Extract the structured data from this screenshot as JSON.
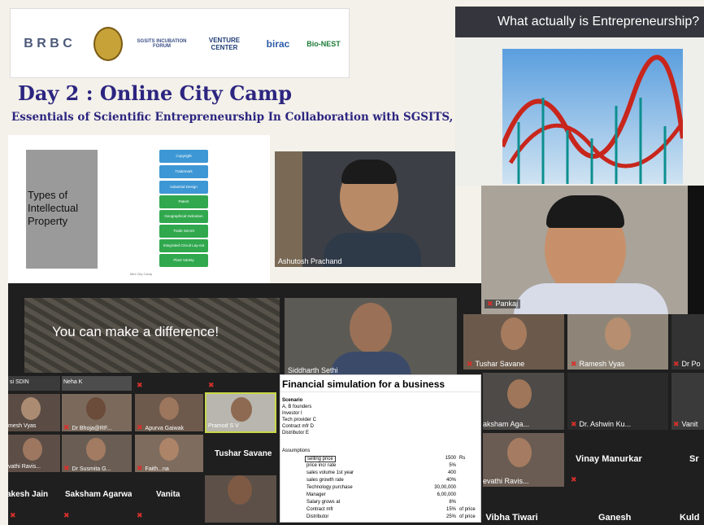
{
  "logos": [
    "B R B C",
    "SGSITS INCUBATION FORUM",
    "VENTURE CENTER",
    "birac",
    "Bio-NEST"
  ],
  "title": "Day 2 : Online City Camp",
  "subtitle": "Essentials of Scientific Entrepreneurship In Collaboration with SGSITS, Indore",
  "ip_slide": {
    "title": "Types of Intellectual Property",
    "items": [
      "Copyright",
      "Trademark",
      "Industrial Design",
      "Patent",
      "Geographical Indication",
      "Trade Secret",
      "Integrated Circuit Lay-out",
      "Plant Variety"
    ],
    "footer": "Mini City Camp"
  },
  "entrepreneurship_heading": "What actually is Entrepreneurship?",
  "difference_text": "You can make a difference!",
  "participants": {
    "ashutosh": "Ashutosh Prachand",
    "pankaj": "Pankaj",
    "siddharth": "Siddharth Sethi",
    "tushar": "Tushar Savane",
    "ramesh": "Ramesh Vyas",
    "dr_po": "Dr Po",
    "saksham_small": "aksham Aga...",
    "ashwin": "Dr. Ashwin Ku...",
    "vanit": "Vanit",
    "vinay": "Vinay Manurkar",
    "sr": "Sr",
    "revathi_r": "evathi Ravis...",
    "vibha": "r Vibha Tiwari",
    "ganesh": "Ganesh",
    "kuld": "Kuld",
    "sdin": "si SDIN",
    "neha": "Neha K",
    "ramesh_l": "mesh Vyas",
    "bhoja": "Dr Bhoja@RF...",
    "apurva": "Apurva Gaiwak",
    "pramod": "Pramod S V",
    "tushar_big": "Tushar Savane",
    "revathi_l": "vathi Ravis...",
    "susmita": "Dr Susmita G...",
    "faith": "Faith...na",
    "akesh": "akesh Jain",
    "saksham_agarwal": "Saksham Agarwal",
    "vanita": "Vanita"
  },
  "sheet": {
    "title": "Financial simulation for a business",
    "scenario_label": "Scenario",
    "scenario": [
      "A, B founders",
      "Investor I",
      "Tech provider C",
      "Contract mfr D",
      "Distributor E"
    ],
    "assumptions_label": "Assumptions",
    "rows": [
      {
        "label": "selling price",
        "value": "1500",
        "unit": "Rs"
      },
      {
        "label": "price incr rate",
        "value": "5%",
        "unit": ""
      },
      {
        "label": "sales volume 1st year",
        "value": "400",
        "unit": ""
      },
      {
        "label": "sales growth rate",
        "value": "40%",
        "unit": ""
      },
      {
        "label": "Technology purchase",
        "value": "30,00,000",
        "unit": ""
      },
      {
        "label": "Manager",
        "value": "6,00,000",
        "unit": ""
      },
      {
        "label": "Salary grows at",
        "value": "8%",
        "unit": ""
      },
      {
        "label": "Contract mfr",
        "value": "15%",
        "unit": "of price"
      },
      {
        "label": "Distributor",
        "value": "25%",
        "unit": "of price"
      }
    ]
  }
}
